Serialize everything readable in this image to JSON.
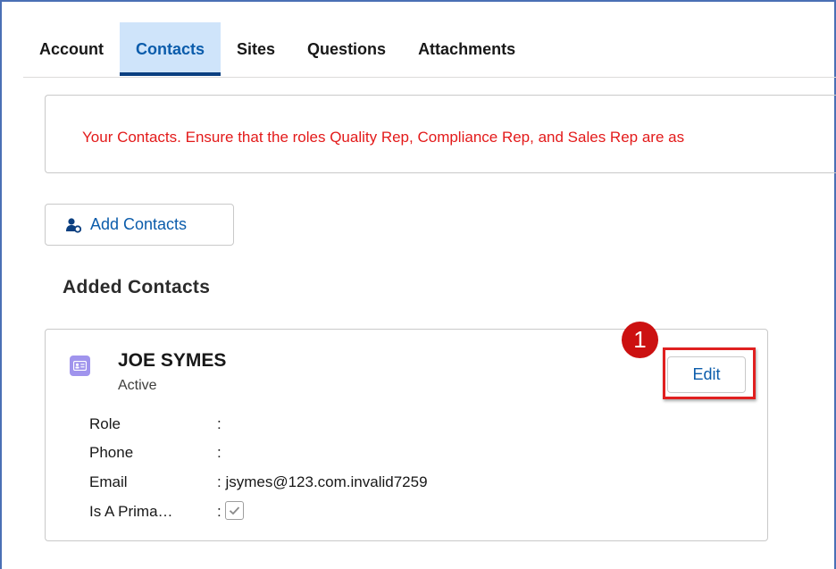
{
  "tabs": [
    {
      "label": "Account",
      "active": false
    },
    {
      "label": "Contacts",
      "active": true
    },
    {
      "label": "Sites",
      "active": false
    },
    {
      "label": "Questions",
      "active": false
    },
    {
      "label": "Attachments",
      "active": false
    }
  ],
  "info_message": "Your Contacts. Ensure that the roles Quality Rep, Compliance Rep, and Sales Rep are as",
  "add_contacts_label": "Add Contacts",
  "section_title": "Added Contacts",
  "contact": {
    "name": "JOE SYMES",
    "status": "Active",
    "edit_label": "Edit",
    "fields": [
      {
        "label": "Role",
        "value": ":"
      },
      {
        "label": "Phone",
        "value": ":"
      },
      {
        "label": "Email",
        "value": ": jsymes@123.com.invalid7259"
      },
      {
        "label": "Is A Prima…",
        "value": ":",
        "checked": true
      }
    ]
  },
  "callout_number": "1",
  "colors": {
    "accent": "#0b5cab",
    "active_tab_bg": "#cfe4fa",
    "warning_text": "#e31a1a",
    "highlight": "#e02020",
    "avatar": "#a094ed"
  },
  "icons": {
    "add_contacts": "person-add-icon",
    "avatar": "contact-card-icon",
    "checkbox": "checkmark-icon"
  }
}
